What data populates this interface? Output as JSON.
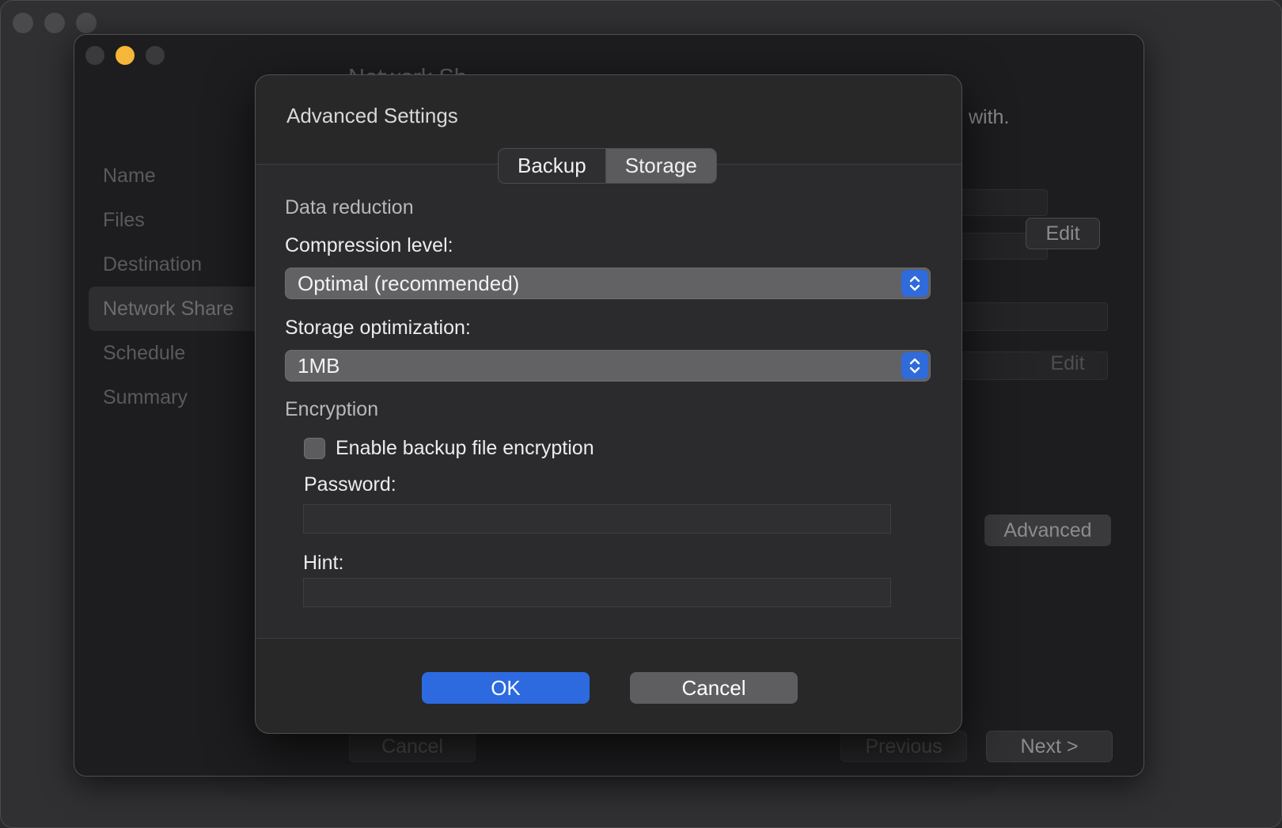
{
  "background_window": {
    "steps": [
      "Name",
      "Files",
      "Destination",
      "Network Share",
      "Schedule",
      "Summary"
    ],
    "active_step": "Network Share",
    "title_partial": "Network Sh",
    "description_tail": "with.",
    "edit_label": "Edit",
    "edit_label_2": "Edit",
    "advanced_label": "Advanced",
    "cancel_label": "Cancel",
    "previous_label": "Previous",
    "next_label": "Next >"
  },
  "dialog": {
    "title": "Advanced Settings",
    "tabs": [
      {
        "label": "Backup",
        "selected": false
      },
      {
        "label": "Storage",
        "selected": true
      }
    ],
    "data_reduction": {
      "heading": "Data reduction",
      "compression_label": "Compression level:",
      "compression_value": "Optimal (recommended)",
      "storage_opt_label": "Storage optimization:",
      "storage_opt_value": "1MB"
    },
    "encryption": {
      "heading": "Encryption",
      "checkbox_label": "Enable backup file encryption",
      "checked": false,
      "password_label": "Password:",
      "password_value": "",
      "hint_label": "Hint:",
      "hint_value": ""
    },
    "ok_label": "OK",
    "cancel_label": "Cancel"
  },
  "colors": {
    "accent": "#2d6ae0",
    "traffic_minimize": "#f5b63a"
  }
}
